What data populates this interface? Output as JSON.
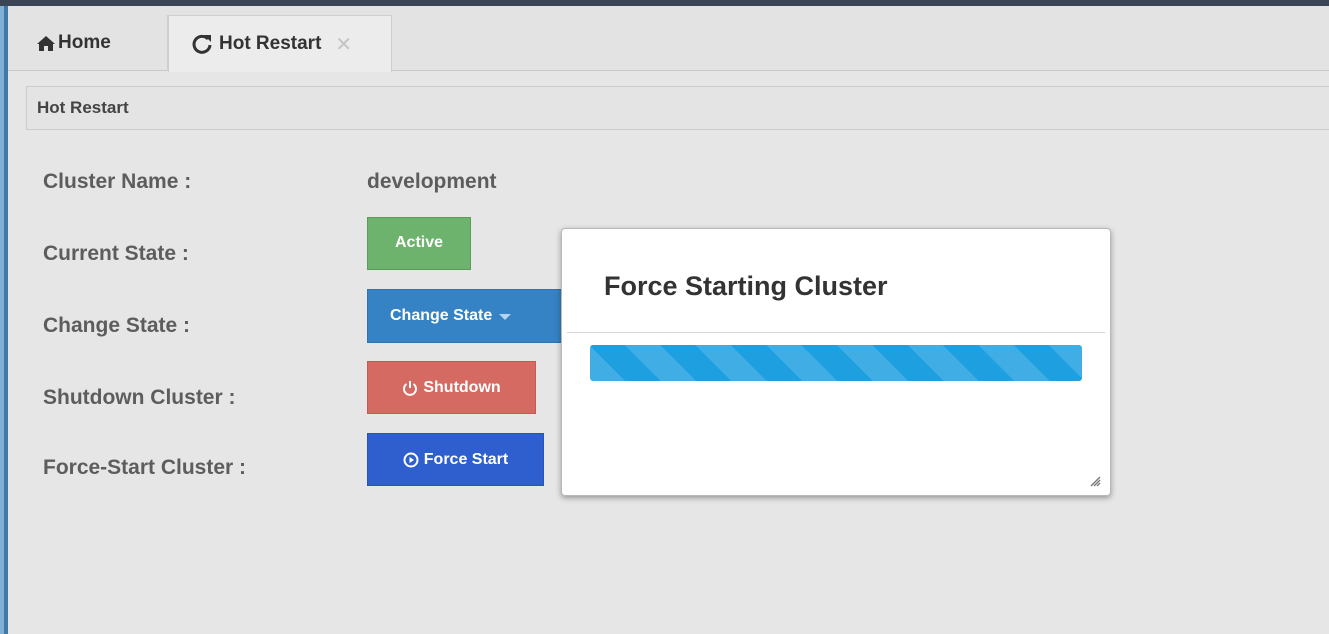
{
  "tabs": [
    {
      "label": "Home",
      "icon": "home-icon"
    },
    {
      "label": "Hot Restart",
      "icon": "refresh-icon",
      "close_glyph": "✕"
    }
  ],
  "panel": {
    "title": "Hot Restart"
  },
  "fields": {
    "cluster_name_label": "Cluster Name :",
    "cluster_name_value": "development",
    "current_state_label": "Current State :",
    "change_state_label": "Change State :",
    "shutdown_label": "Shutdown Cluster :",
    "force_start_label": "Force-Start Cluster :"
  },
  "buttons": {
    "active": "Active",
    "change_state": "Change State",
    "shutdown": "Shutdown",
    "force_start": "Force Start"
  },
  "dialog": {
    "title": "Force Starting Cluster",
    "progress_fraction": 1.0
  },
  "colors": {
    "active": "#6db26d",
    "change_state": "#3582c4",
    "shutdown": "#d56a62",
    "force_start": "#2f5fce",
    "progress": "#1e9fe0"
  }
}
